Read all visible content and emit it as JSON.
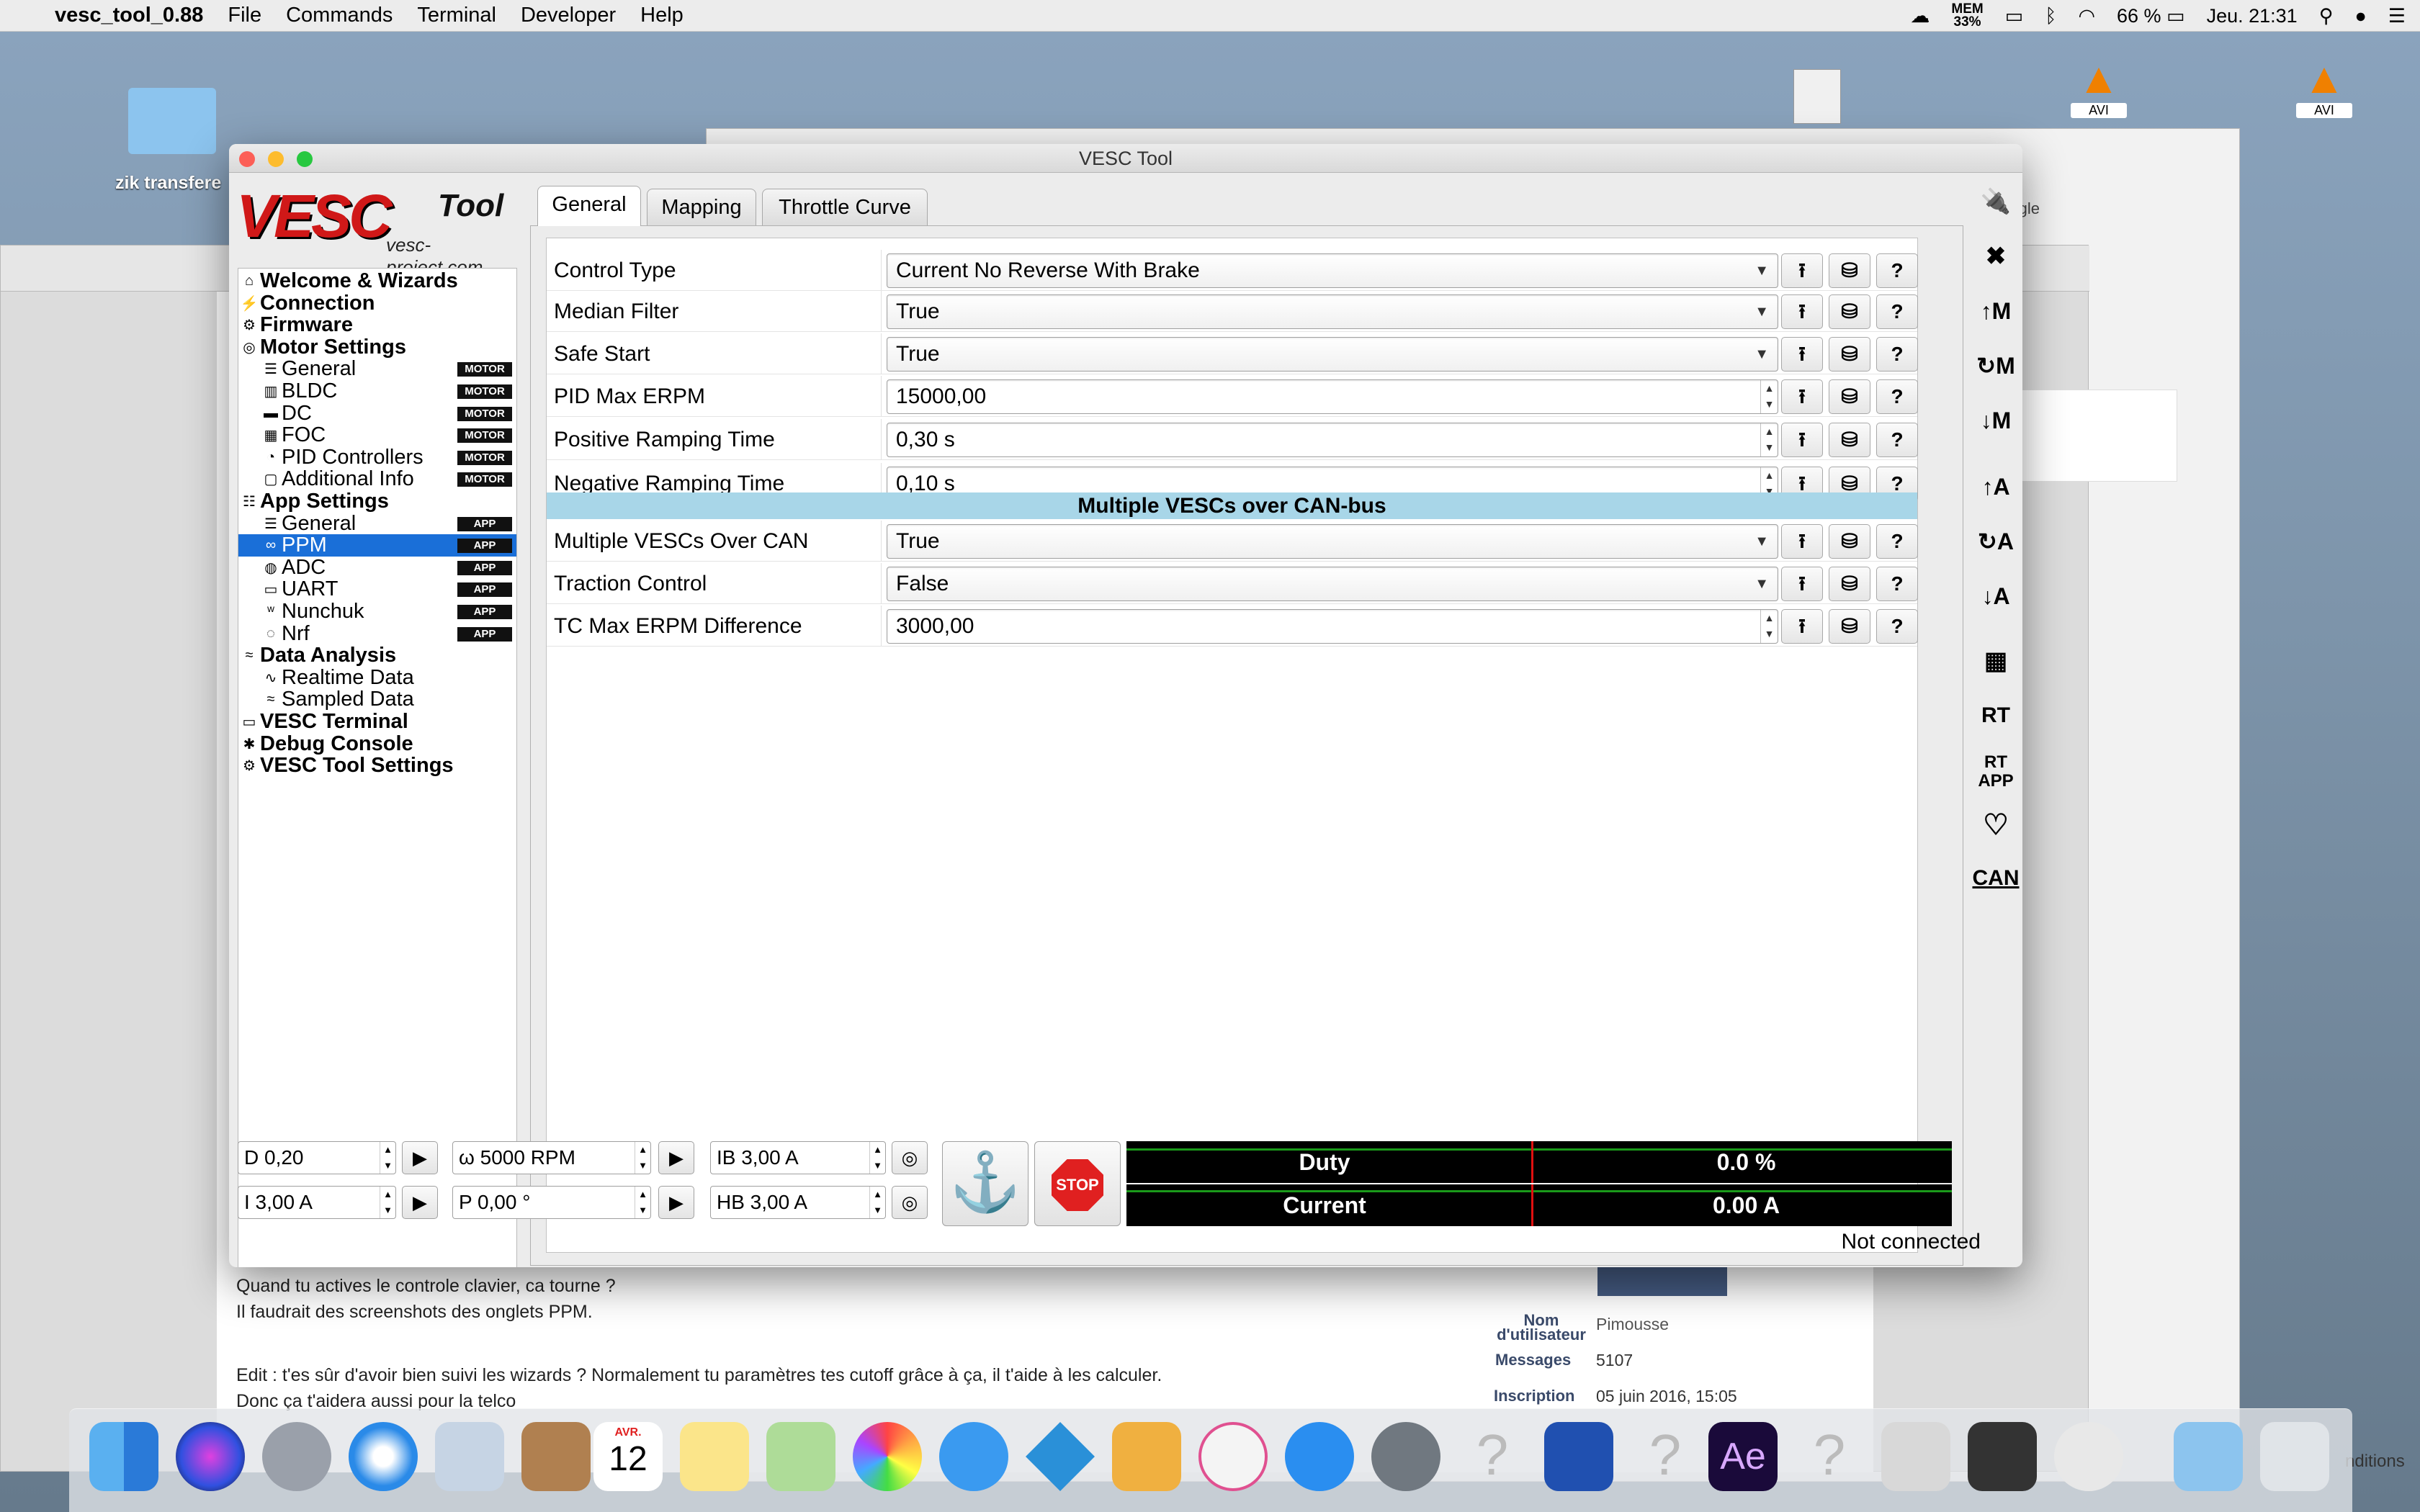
{
  "menubar": {
    "app_name": "vesc_tool_0.88",
    "items": [
      "File",
      "Commands",
      "Terminal",
      "Developer",
      "Help"
    ],
    "mem_label": "MEM",
    "mem_value": "33%",
    "battery": "66 %",
    "clock": "Jeu. 21:31"
  },
  "desktop": {
    "folder_label": "zik transfere",
    "file_label_1": "AVI",
    "file_label_2": "AVI",
    "browser_tab": "Google"
  },
  "window": {
    "title": "VESC Tool",
    "status": "Not connected"
  },
  "logo": {
    "vesc": "VESC",
    "tool": "Tool",
    "url": "vesc-project.com"
  },
  "sidebar": [
    {
      "label": "Welcome & Wizards",
      "type": "top",
      "icon": "⌂"
    },
    {
      "label": "Connection",
      "type": "top",
      "icon": "⚡"
    },
    {
      "label": "Firmware",
      "type": "top",
      "icon": "⚙"
    },
    {
      "label": "Motor Settings",
      "type": "top",
      "icon": "◎"
    },
    {
      "label": "General",
      "type": "sub",
      "badge": "MOTOR",
      "icon": "☰"
    },
    {
      "label": "BLDC",
      "type": "sub",
      "badge": "MOTOR",
      "icon": "▥"
    },
    {
      "label": "DC",
      "type": "sub",
      "badge": "MOTOR",
      "icon": "▬"
    },
    {
      "label": "FOC",
      "type": "sub",
      "badge": "MOTOR",
      "icon": "▦"
    },
    {
      "label": "PID Controllers",
      "type": "sub",
      "badge": "MOTOR",
      "icon": "◔"
    },
    {
      "label": "Additional Info",
      "type": "sub",
      "badge": "MOTOR",
      "icon": "▢"
    },
    {
      "label": "App Settings",
      "type": "top",
      "icon": "☷"
    },
    {
      "label": "General",
      "type": "sub",
      "badge": "APP",
      "icon": "☰"
    },
    {
      "label": "PPM",
      "type": "sub",
      "badge": "APP",
      "icon": "∞",
      "selected": true
    },
    {
      "label": "ADC",
      "type": "sub",
      "badge": "APP",
      "icon": "◍"
    },
    {
      "label": "UART",
      "type": "sub",
      "badge": "APP",
      "icon": "▭"
    },
    {
      "label": "Nunchuk",
      "type": "sub",
      "badge": "APP",
      "icon": "ʷ"
    },
    {
      "label": "Nrf",
      "type": "sub",
      "badge": "APP",
      "icon": "◌"
    },
    {
      "label": "Data Analysis",
      "type": "top",
      "icon": "≈"
    },
    {
      "label": "Realtime Data",
      "type": "sub",
      "icon": "∿"
    },
    {
      "label": "Sampled Data",
      "type": "sub",
      "icon": "≈"
    },
    {
      "label": "VESC Terminal",
      "type": "top",
      "icon": "▭"
    },
    {
      "label": "Debug Console",
      "type": "top",
      "icon": "✱"
    },
    {
      "label": "VESC Tool Settings",
      "type": "top",
      "icon": "⚙"
    }
  ],
  "tabs": [
    "General",
    "Mapping",
    "Throttle Curve"
  ],
  "params": [
    {
      "label": "Control Type",
      "value": "Current No Reverse With Brake",
      "kind": "combo"
    },
    {
      "label": "Median Filter",
      "value": "True",
      "kind": "combo"
    },
    {
      "label": "Safe Start",
      "value": "True",
      "kind": "combo"
    },
    {
      "label": "PID Max ERPM",
      "value": "15000,00",
      "kind": "spin"
    },
    {
      "label": "Positive Ramping Time",
      "value": "0,30 s",
      "kind": "spin"
    },
    {
      "label": "Negative Ramping Time",
      "value": "0,10 s",
      "kind": "spin"
    }
  ],
  "section_title": "Multiple VESCs over CAN-bus",
  "params2": [
    {
      "label": "Multiple VESCs Over CAN",
      "value": "True",
      "kind": "combo"
    },
    {
      "label": "Traction Control",
      "value": "False",
      "kind": "combo"
    },
    {
      "label": "TC Max ERPM Difference",
      "value": "3000,00",
      "kind": "spin"
    }
  ],
  "right_toolbar": [
    "↑M",
    "↻M",
    "↓M",
    "↑A",
    "↻A",
    "↓A",
    "RT",
    "RT APP",
    "CAN"
  ],
  "controls": {
    "duty": "D 0,20",
    "current": "I 3,00 A",
    "rpm": "ω 5000 RPM",
    "position": "P 0,00 °",
    "ib": "IB 3,00 A",
    "hb": "HB 3,00 A",
    "stop": "STOP"
  },
  "gauges": [
    {
      "label": "Duty",
      "value": "0.0 %"
    },
    {
      "label": "Current",
      "value": "0.00 A"
    }
  ],
  "forum": {
    "line1": "Quand tu actives le controle clavier, ca tourne ?",
    "line2": "Il faudrait des screenshots des onglets PPM.",
    "line3": "Edit : t'es sûr d'avoir bien suivi les wizards ? Normalement tu paramètres tes cutoff grâce à ça, il t'aide à les calculer.",
    "line4": "Donc ça t'aidera aussi pour la telco",
    "nom_label": "Nom d'utilisateur",
    "nom_value": "Pimousse",
    "msg_label": "Messages",
    "msg_value": "5107",
    "ins_label": "Inscription",
    "ins_value": "05 juin 2016, 15:05",
    "side_text": "nditions"
  },
  "dock": {
    "calendar_month": "AVR.",
    "calendar_day": "12",
    "ae": "Ae"
  }
}
